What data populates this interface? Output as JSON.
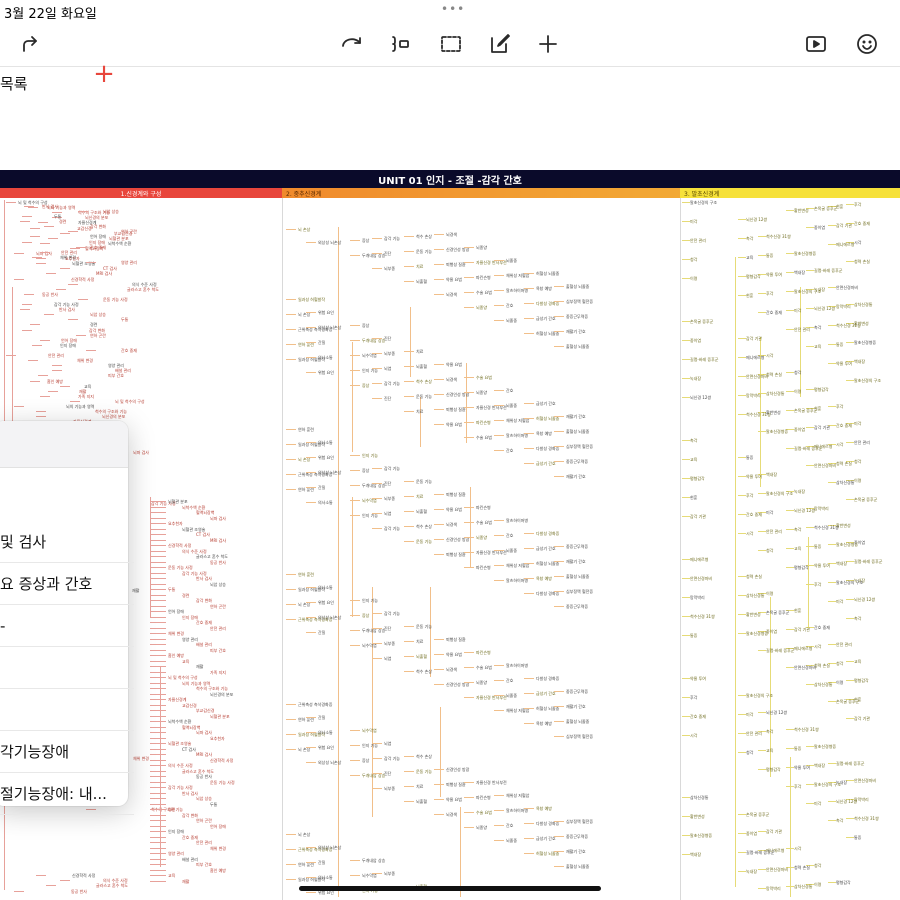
{
  "status": {
    "date": "3월 22일 화요일",
    "dots": "•••"
  },
  "toolbar": {
    "icons": [
      "redo-icon",
      "lasso-icon",
      "focus-icon",
      "select-icon",
      "edit-icon",
      "add-icon",
      "play-icon",
      "smiley-icon"
    ]
  },
  "mindmap": {
    "title": "UNIT 01 인지 - 조절 -감각 간호",
    "column_headers": [
      "1.신경계와 구성",
      "2. 중추신경계",
      "3. 말초신경계"
    ],
    "colors": {
      "title_bg": "#0a0a2a",
      "col1": "#e8463c",
      "col2": "#f08a2c",
      "col3": "#f6e13a"
    },
    "col1_nodes": [
      "뇌 및 척수의 구성",
      "뇌의 기능과 영역",
      "척수의 구조와 기능",
      "뇌신경의 분포",
      "자율신경계",
      "교감신경",
      "부교감신경",
      "뇌혈관 분포",
      "뇌척수액 순환",
      "혈액뇌장벽",
      "뇌파 검사",
      "요추천자",
      "뇌혈관 조영술",
      "CT 검사",
      "MRI 검사",
      "신경학적 사정",
      "의식 수준 사정",
      "글라스고 혼수 척도",
      "동공 반사",
      "운동 기능 사정",
      "감각 기능 사정",
      "반사 검사",
      "뇌압 상승",
      "두통",
      "경련",
      "감각 변화",
      "연하 곤란",
      "언어 장애",
      "인지 장애",
      "간호 중재",
      "안전 관리",
      "체위 변경",
      "영양 관리",
      "배설 관리",
      "피부 간호",
      "흡인 예방",
      "교육",
      "재활",
      "가족 지지"
    ],
    "col2_nodes": [
      "뇌 손상",
      "외상성 뇌손상",
      "두개내압 상승",
      "뇌부종",
      "뇌출혈",
      "뇌경색",
      "뇌종양",
      "뇌졸중",
      "허혈성 뇌졸중",
      "출혈성 뇌졸중",
      "일과성 허혈발작",
      "위험 요인",
      "증상",
      "진단",
      "치료",
      "약물 요법",
      "수술 요법",
      "간호",
      "급성기 간호",
      "재활기 간호",
      "연하 훈련",
      "의사소통",
      "인지 기능",
      "감각 기능",
      "운동 기능",
      "퇴행성 질환",
      "파킨슨병",
      "알츠하이머병",
      "다발성 경화증",
      "중증근무력증",
      "근위축성 측삭경화증",
      "간질",
      "뇌수막염",
      "뇌염",
      "척수 손상",
      "신경인성 방광",
      "자율신경 반사부전",
      "체위성 저혈압",
      "욕창 예방",
      "심부정맥 혈전증"
    ],
    "col3_nodes": [
      "말초신경의 구조",
      "뇌신경 12쌍",
      "척수신경 31쌍",
      "말초신경병증",
      "길랭-바레 증후군",
      "안면신경마비",
      "삼차신경통",
      "손목굴 증후군",
      "감각 기관",
      "시각",
      "청각",
      "평형감각",
      "후각",
      "미각",
      "촉각",
      "통증",
      "백내장",
      "녹내장",
      "망막박리",
      "황반변성",
      "중이염",
      "메니에르병",
      "청력 손실",
      "이명",
      "현훈",
      "간호 중재",
      "안전 관리",
      "교육",
      "약물 투여"
    ]
  },
  "outline": {
    "title": "목록",
    "add_label": "+",
    "items": [
      "및 검사",
      "요 증상과 간호",
      "-",
      "",
      "",
      "각기능장애",
      "절기능장애: 내..."
    ]
  }
}
